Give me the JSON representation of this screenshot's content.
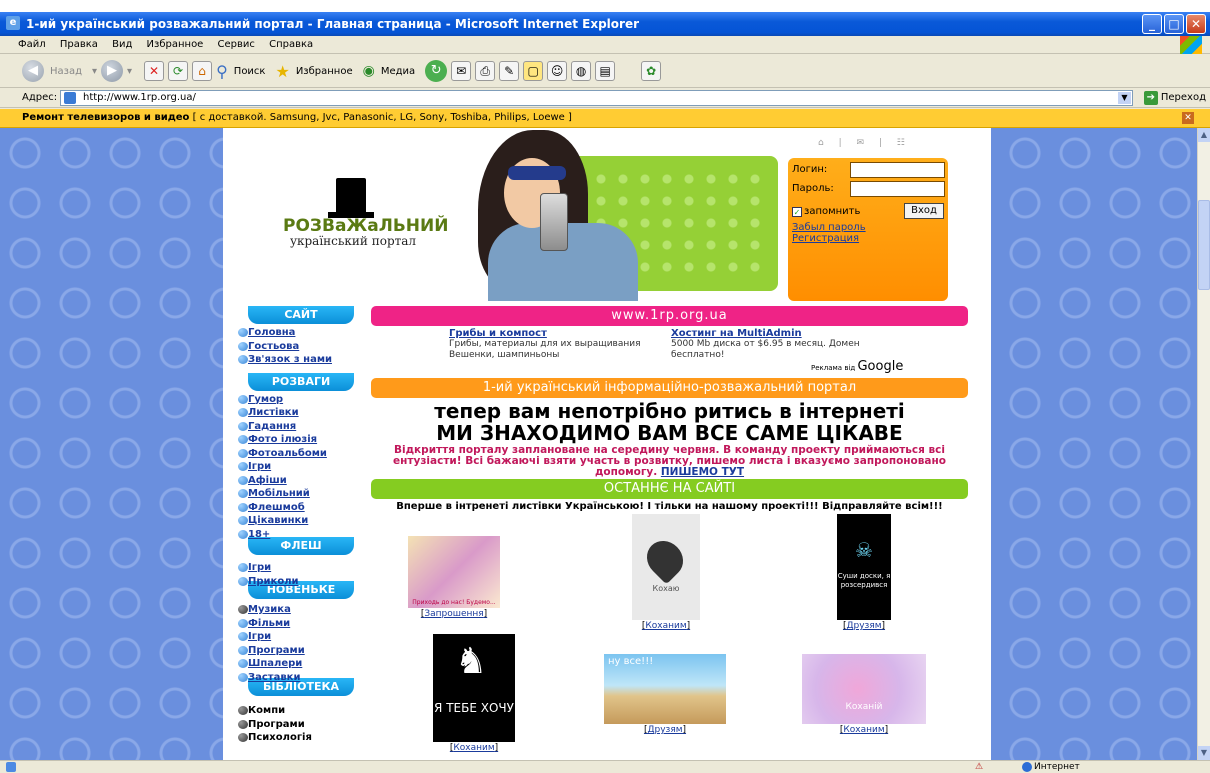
{
  "window": {
    "title": "1-ий український розважальний портал - Главная страница - Microsoft Internet Explorer"
  },
  "menu": [
    "Файл",
    "Правка",
    "Вид",
    "Избранное",
    "Сервис",
    "Справка"
  ],
  "toolbar": {
    "back": "Назад",
    "search": "Поиск",
    "favorites": "Избранное",
    "media": "Медиа"
  },
  "address": {
    "label": "Адрес:",
    "url": "http://www.1rp.org.ua/",
    "go": "Переход"
  },
  "adbar": {
    "title": "Ремонт телевизоров и видео",
    "text": "[ с доставкой. Samsung, Jvc, Panasonic, LG, Sony, Toshiba, Philips, Loewe ]"
  },
  "status": {
    "zone": "Интернет"
  },
  "logo": {
    "line1": "РОЗВаЖаЛЬНИЙ",
    "line2": "український портал"
  },
  "login": {
    "login_label": "Логин:",
    "password_label": "Пароль:",
    "remember": "запомнить",
    "enter": "Вход",
    "forgot": "Забыл пароль",
    "register": "Регистрация"
  },
  "sidebar": {
    "site_head": "САЙТ",
    "site": [
      "Головна",
      "Гостьова",
      "Зв'язок з нами"
    ],
    "fun_head": "РОЗВАГИ",
    "fun": [
      "Гумор",
      "Листівки",
      "Гадання",
      "Фото ілюзія",
      "Фотоальбоми",
      "Ігри",
      "Афіши",
      "Мобільний",
      "Флешмоб",
      "Цікавинки",
      "18+"
    ],
    "flash_head": "ФЛЕШ",
    "flash": [
      "Ігри",
      "Приколи"
    ],
    "new_head": "НОВЕНЬКЕ",
    "new": [
      "Музика",
      "Фільми",
      "Ігри",
      "Програми",
      "Шпалери",
      "Заставки"
    ],
    "lib_head": "БІБЛІОТЕКА",
    "lib": [
      "Компи",
      "Програми",
      "Психологія"
    ]
  },
  "main": {
    "site_bar": "www.1rp.org.ua",
    "ad1_title": "Грибы и компост",
    "ad1_text": "Грибы, материалы для их выращивания Вешенки, шампиньоны",
    "ad2_title": "Хостинг на MultiAdmin",
    "ad2_text": "5000 Mb диска от $6.95 в месяц. Домен бесплатно!",
    "google_prefix": "Реклама від",
    "google": "Google",
    "portal_bar": "1-ий український інформаційно-розважальний портал",
    "tag1": "тепер вам непотрібно ритись в інтернеті",
    "tag2": "МИ ЗНАХОДИМО ВАМ ВСЕ САМЕ ЦІКАВЕ",
    "announce": "Відкриття порталу заплановане на середину червня. В команду проекту приймаються всі ентузіасти! Всі бажаючі взяти участь в розвитку, пишемо листа і вказуємо запропоновано допомогу.",
    "announce_link": "ПИШЕМО ТУТ",
    "latest_bar": "ОСТАННЄ НА САЙТІ",
    "intro": "Вперше в інтренеті листівки Українською! І тільки на нашому проекті!!! Відправляйте всім!!!",
    "cards": [
      {
        "caption": "Запрошення",
        "text": "Приходь до нас! Будемо..."
      },
      {
        "caption": "Коханим",
        "text": "Кохаю"
      },
      {
        "caption": "Друзям",
        "text": "Суши доски, я розсердився"
      },
      {
        "caption": "Коханим",
        "text": "Я ТЕБЕ ХОЧУ"
      },
      {
        "caption": "Друзям",
        "text": "ну все!!!"
      },
      {
        "caption": "Коханим",
        "text": "Коханій"
      }
    ]
  }
}
